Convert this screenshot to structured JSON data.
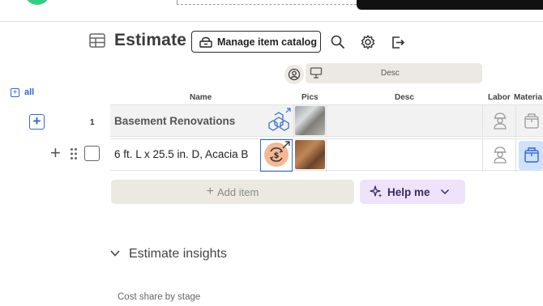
{
  "header": {
    "title": "Estimate",
    "catalog_button": "Manage item catalog",
    "icons": [
      "table-icon",
      "search-icon",
      "gear-icon",
      "export-icon"
    ]
  },
  "columns": {
    "group_label": "Desc",
    "select_all": "all",
    "name": "Name",
    "pics": "Pics",
    "desc": "Desc",
    "labor": "Labor",
    "material": "Materia"
  },
  "rows": [
    {
      "number": "1",
      "name": "Basement Renovations"
    },
    {
      "number": "",
      "name": "6 ft. L x 25.5 in. D, Acacia B"
    }
  ],
  "actions": {
    "add_item": "Add item",
    "help_me": "Help me"
  },
  "insights": {
    "title": "Estimate insights",
    "cost_share": "Cost share by stage"
  },
  "colors": {
    "accent": "#2f67d8",
    "help_bg": "#efe2fb",
    "neutral_fill": "#ece9e2"
  }
}
